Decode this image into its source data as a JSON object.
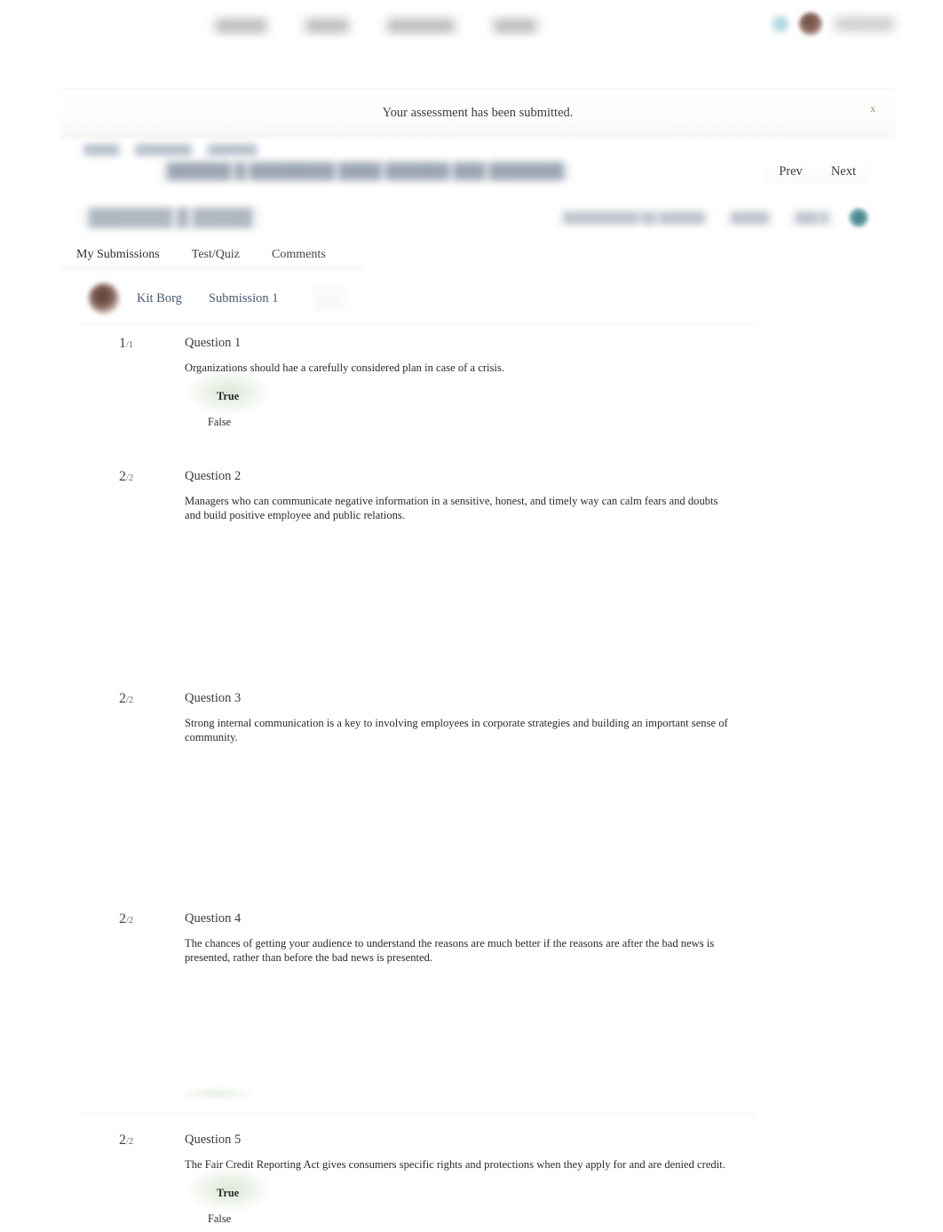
{
  "topnav": {
    "items": [
      "██████",
      "█████",
      "████████",
      "█████"
    ],
    "username": "███████",
    "bell_icon": "bell-icon",
    "avatar_icon": "user-avatar"
  },
  "banner": {
    "message": "Your assessment has been submitted.",
    "close_label": "x",
    "accent_color": "#7d9a6b"
  },
  "breadcrumb": {
    "items": [
      "█████",
      "████████",
      "███████"
    ],
    "title": "██████ █ ████████ ████ ██████ ███ ███████"
  },
  "pager": {
    "prev_label": "Prev",
    "next_label": "Next"
  },
  "header": {
    "title": "███████ █ █████",
    "meta_1": "██████████ ██ ██████",
    "meta_2": "█████",
    "meta_3": "███ █"
  },
  "tabs": [
    {
      "label": "My Submissions",
      "active": true
    },
    {
      "label": "Test/Quiz",
      "active": false
    },
    {
      "label": "Comments",
      "active": false
    }
  ],
  "submission": {
    "student_name": "Kit Borg",
    "attempt_label": "Submission 1"
  },
  "questions": [
    {
      "score": "1",
      "out_of": "/1",
      "label": "Question 1",
      "text": "Organizations should hae a carefully considered plan in case of a crisis.",
      "options": [
        {
          "label": "True",
          "selected": true
        },
        {
          "label": "False",
          "selected": false
        }
      ]
    },
    {
      "score": "2",
      "out_of": "/2",
      "label": "Question 2",
      "text": "Managers who can communicate negative information in a sensitive, honest, and timely way can calm fears and doubts and build positive employee and public relations.",
      "options": []
    },
    {
      "score": "2",
      "out_of": "/2",
      "label": "Question 3",
      "text": "Strong internal communication is a key to involving employees in corporate strategies and building an important sense of community.",
      "options": []
    },
    {
      "score": "2",
      "out_of": "/2",
      "label": "Question 4",
      "text": "The chances of getting your audience to understand the reasons are much better if the reasons are after the bad news is presented, rather than before the bad news is presented.",
      "options": []
    },
    {
      "score": "2",
      "out_of": "/2",
      "label": "Question 5",
      "text": "The Fair Credit Reporting Act gives consumers specific rights and protections when they apply for and are denied credit.",
      "options": [
        {
          "label": "True",
          "selected": true
        },
        {
          "label": "False",
          "selected": false
        }
      ]
    }
  ]
}
